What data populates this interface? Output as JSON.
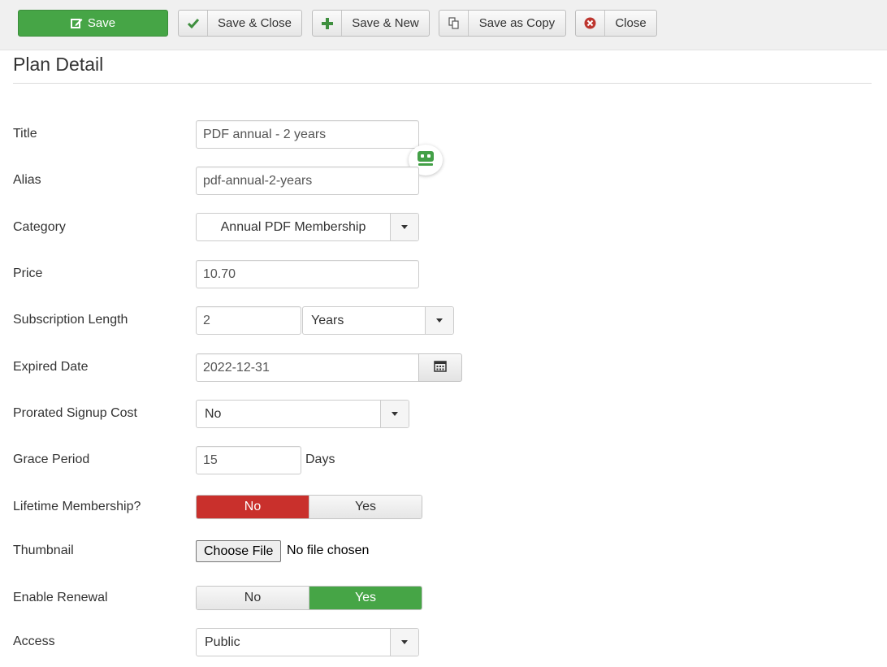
{
  "toolbar": {
    "save": "Save",
    "save_close": "Save & Close",
    "save_new": "Save & New",
    "save_copy": "Save as Copy",
    "close": "Close"
  },
  "page": {
    "title": "Plan Detail"
  },
  "form": {
    "title": {
      "label": "Title",
      "value": "PDF annual - 2 years"
    },
    "alias": {
      "label": "Alias",
      "value": "pdf-annual-2-years"
    },
    "category": {
      "label": "Category",
      "value": "Annual PDF Membership"
    },
    "price": {
      "label": "Price",
      "value": "10.70"
    },
    "subscription_length": {
      "label": "Subscription Length",
      "value": "2",
      "unit": "Years"
    },
    "expired_date": {
      "label": "Expired Date",
      "value": "2022-12-31"
    },
    "prorated": {
      "label": "Prorated Signup Cost",
      "value": "No"
    },
    "grace_period": {
      "label": "Grace Period",
      "value": "15",
      "unit": "Days"
    },
    "lifetime": {
      "label": "Lifetime Membership?",
      "no": "No",
      "yes": "Yes",
      "selected": "No"
    },
    "thumbnail": {
      "label": "Thumbnail",
      "button": "Choose File",
      "status": "No file chosen"
    },
    "renewal": {
      "label": "Enable Renewal",
      "no": "No",
      "yes": "Yes",
      "selected": "Yes"
    },
    "access": {
      "label": "Access",
      "value": "Public"
    }
  },
  "colors": {
    "save_green": "#46a546",
    "toggle_red": "#c9302c",
    "toggle_green": "#46a546"
  },
  "icons": [
    "edit-icon",
    "check-icon",
    "plus-icon",
    "copy-icon",
    "close-circle-icon",
    "calendar-icon",
    "roboform-icon"
  ]
}
